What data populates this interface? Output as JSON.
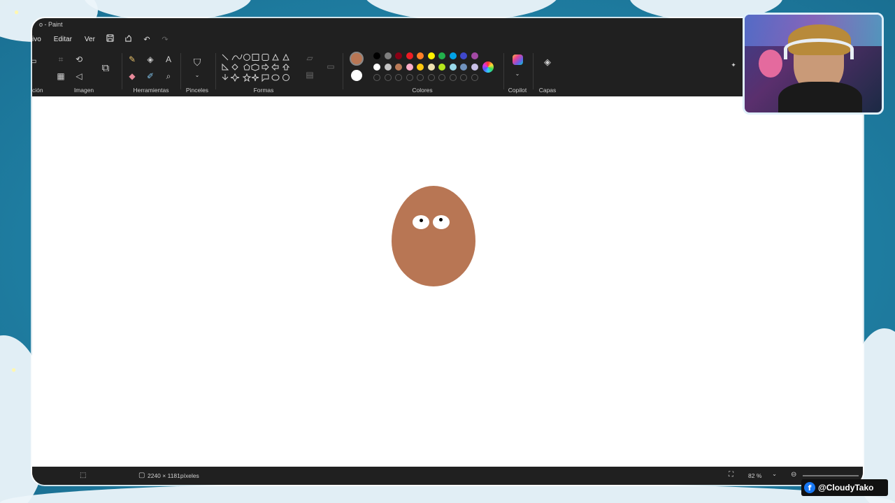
{
  "window": {
    "title": "o - Paint"
  },
  "menu": {
    "file_partial": "ivo",
    "edit": "Editar",
    "view": "Ver"
  },
  "quick_access": {
    "save_icon": "save-icon",
    "share_icon": "share-icon",
    "undo_icon": "undo-icon",
    "redo_icon": "redo-icon"
  },
  "ribbon": {
    "partial_label": "ción",
    "image": {
      "label": "Imagen",
      "icons": [
        "crop-icon",
        "rotate-icon",
        "resize-icon",
        "select-icon",
        "image-select-icon"
      ]
    },
    "tools": {
      "label": "Herramientas",
      "icons": [
        "pencil-icon",
        "fill-icon",
        "text-icon",
        "eraser-icon",
        "color-picker-icon",
        "magnifier-icon"
      ]
    },
    "brushes": {
      "label": "Pinceles"
    },
    "shapes": {
      "label": "Formas"
    },
    "colors": {
      "label": "Colores",
      "current": "#b87654",
      "secondary": "#ffffff",
      "row1": [
        "#000000",
        "#7f7f7f",
        "#880015",
        "#ed1c24",
        "#ff7f27",
        "#fff200",
        "#22b14c",
        "#00a2e8",
        "#3f48cc",
        "#a349a4"
      ],
      "row2": [
        "#ffffff",
        "#c3c3c3",
        "#b97a57",
        "#ffaec9",
        "#ffc90e",
        "#efe4b0",
        "#b5e61d",
        "#99d9ea",
        "#7092be",
        "#c8bfe7"
      ]
    },
    "copilot": {
      "label": "Copilot"
    },
    "layers": {
      "label": "Capas"
    }
  },
  "canvas": {
    "background": "#ffffff",
    "drawing_color": "#b87654"
  },
  "status": {
    "dimensions": "2240 × 1181píxeles",
    "zoom": "82 %"
  },
  "overlay": {
    "social_handle": "@CloudyTako",
    "social_icon": "facebook-icon"
  }
}
